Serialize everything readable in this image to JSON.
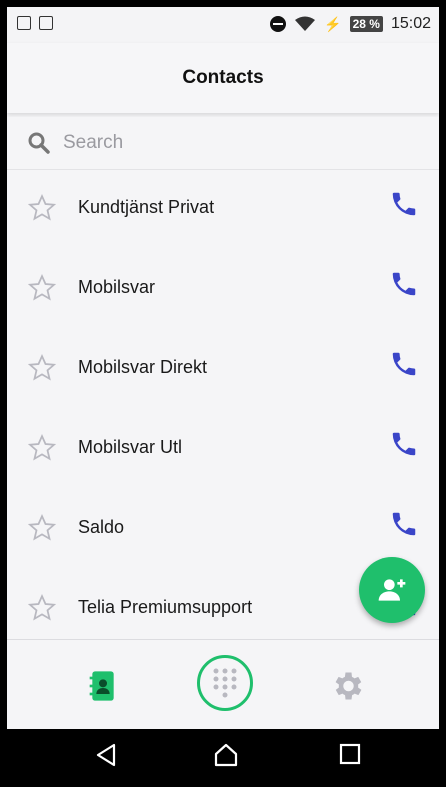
{
  "status_bar": {
    "time": "15:02",
    "battery": "28 %",
    "icons": [
      "notification-icon",
      "image-icon",
      "do-not-disturb-icon",
      "wifi-icon",
      "charging-icon"
    ]
  },
  "header": {
    "title": "Contacts"
  },
  "search": {
    "placeholder": "Search",
    "value": ""
  },
  "contacts": [
    {
      "name": "Kundtjänst Privat"
    },
    {
      "name": "Mobilsvar"
    },
    {
      "name": "Mobilsvar Direkt"
    },
    {
      "name": "Mobilsvar Utl"
    },
    {
      "name": "Saldo"
    },
    {
      "name": "Telia Premiumsupport"
    }
  ],
  "colors": {
    "accent_green": "#1fbf6c",
    "call_blue": "#3a45c8",
    "star_gray": "#b8b8c0"
  },
  "bottom_nav": {
    "items": [
      "contacts-book-icon",
      "dialpad-icon",
      "gear-icon"
    ]
  },
  "system_nav": {
    "items": [
      "back-icon",
      "home-icon",
      "recents-icon"
    ]
  }
}
